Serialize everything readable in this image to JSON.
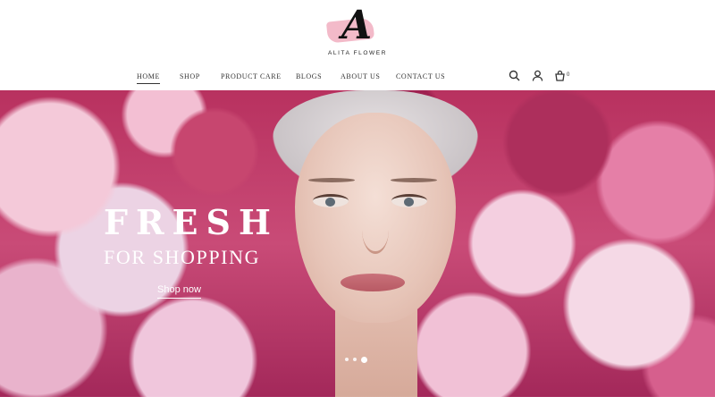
{
  "brand": {
    "letter": "A",
    "name": "ALITA FLOWER"
  },
  "nav": {
    "items": [
      {
        "label": "HOME",
        "active": true
      },
      {
        "label": "SHOP"
      },
      {
        "label": "PRODUCT CARE"
      },
      {
        "label": "BLOGS"
      },
      {
        "label": "ABOUT US"
      },
      {
        "label": "CONTACT US"
      }
    ],
    "icons": [
      "search-icon",
      "user-icon",
      "cart-icon"
    ],
    "cart_count": "0"
  },
  "hero": {
    "title": "FRESH",
    "subtitle": "FOR SHOPPING",
    "cta_label": "Shop now",
    "slides": 3,
    "active_slide": 3
  },
  "colors": {
    "accent_pink": "#f2b3c3",
    "text_dark": "#333333",
    "hero_bg": "#b8315f"
  }
}
